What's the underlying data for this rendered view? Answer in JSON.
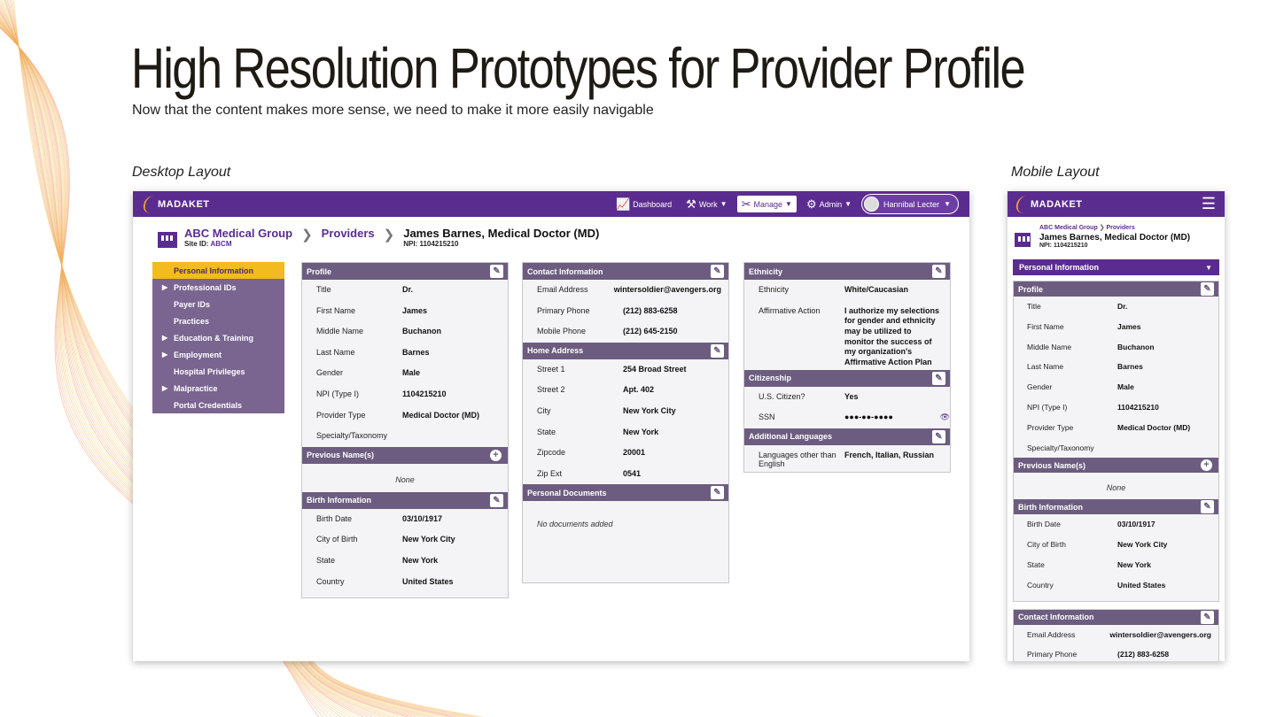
{
  "slide": {
    "title": "High Resolution Prototypes for Provider Profile",
    "subtitle": "Now that the content makes more sense, we need to make it more easily navigable",
    "desktop_label": "Desktop Layout",
    "mobile_label": "Mobile Layout"
  },
  "app": {
    "logo": "MADAKET",
    "nav": {
      "dashboard": "Dashboard",
      "work": "Work",
      "manage": "Manage",
      "admin": "Admin",
      "user": "Hannibal Lecter"
    },
    "brand_color": "#5b2c8f",
    "accent_color": "#f2bb1f"
  },
  "breadcrumb": {
    "org": "ABC Medical Group",
    "site_label": "Site ID:",
    "site_id": "ABCM",
    "providers": "Providers",
    "provider_name": "James Barnes, Medical Doctor (MD)",
    "npi": "NPI: 1104215210"
  },
  "side_menu": [
    {
      "label": "Personal Information",
      "expandable": false
    },
    {
      "label": "Professional IDs",
      "expandable": true
    },
    {
      "label": "Payer IDs",
      "expandable": false
    },
    {
      "label": "Practices",
      "expandable": false
    },
    {
      "label": "Education & Training",
      "expandable": true
    },
    {
      "label": "Employment",
      "expandable": true
    },
    {
      "label": "Hospital Privileges",
      "expandable": false
    },
    {
      "label": "Malpractice",
      "expandable": true
    },
    {
      "label": "Portal Credentials",
      "expandable": false
    }
  ],
  "profile": {
    "title": "Profile",
    "rows": [
      {
        "label": "Title",
        "value": "Dr."
      },
      {
        "label": "First Name",
        "value": "James"
      },
      {
        "label": "Middle Name",
        "value": "Buchanon"
      },
      {
        "label": "Last Name",
        "value": "Barnes"
      },
      {
        "label": "Gender",
        "value": "Male"
      },
      {
        "label": "NPI (Type I)",
        "value": "1104215210"
      },
      {
        "label": "Provider Type",
        "value": "Medical Doctor (MD)"
      },
      {
        "label": "Specialty/Taxonomy",
        "value": ""
      }
    ]
  },
  "previous_names": {
    "title": "Previous Name(s)",
    "none": "None"
  },
  "birth": {
    "title": "Birth Information",
    "rows": [
      {
        "label": "Birth Date",
        "value": "03/10/1917"
      },
      {
        "label": "City of Birth",
        "value": "New York City"
      },
      {
        "label": "State",
        "value": "New York"
      },
      {
        "label": "Country",
        "value": "United States"
      }
    ]
  },
  "contact": {
    "title": "Contact Information",
    "rows": [
      {
        "label": "Email Address",
        "value": "wintersoldier@avengers.org"
      },
      {
        "label": "Primary Phone",
        "value": "(212) 883-6258"
      },
      {
        "label": "Mobile Phone",
        "value": "(212) 645-2150"
      }
    ]
  },
  "home": {
    "title": "Home Address",
    "rows": [
      {
        "label": "Street 1",
        "value": "254 Broad Street"
      },
      {
        "label": "Street 2",
        "value": "Apt. 402"
      },
      {
        "label": "City",
        "value": "New York City"
      },
      {
        "label": "State",
        "value": "New York"
      },
      {
        "label": "Zipcode",
        "value": "20001"
      },
      {
        "label": "Zip Ext",
        "value": "0541"
      }
    ]
  },
  "documents": {
    "title": "Personal Documents",
    "empty": "No documents added"
  },
  "ethnicity": {
    "title": "Ethnicity",
    "rows": [
      {
        "label": "Ethnicity",
        "value": "White/Caucasian"
      },
      {
        "label": "Affirmative Action",
        "value": "I authorize my selections for gender and ethnicity may be utilized to monitor the success of my organization's Affirmative Action Plan"
      }
    ]
  },
  "citizenship": {
    "title": "Citizenship",
    "rows": [
      {
        "label": "U.S. Citizen?",
        "value": "Yes"
      },
      {
        "label": "SSN",
        "value": "●●●-●●-●●●●"
      }
    ]
  },
  "languages": {
    "title": "Additional Languages",
    "rows": [
      {
        "label": "Languages other than English",
        "value": "French, Italian, Russian"
      }
    ]
  },
  "mobile": {
    "crumb_org": "ABC Medical Group",
    "crumb_providers": "Providers",
    "section": "Personal Information"
  }
}
